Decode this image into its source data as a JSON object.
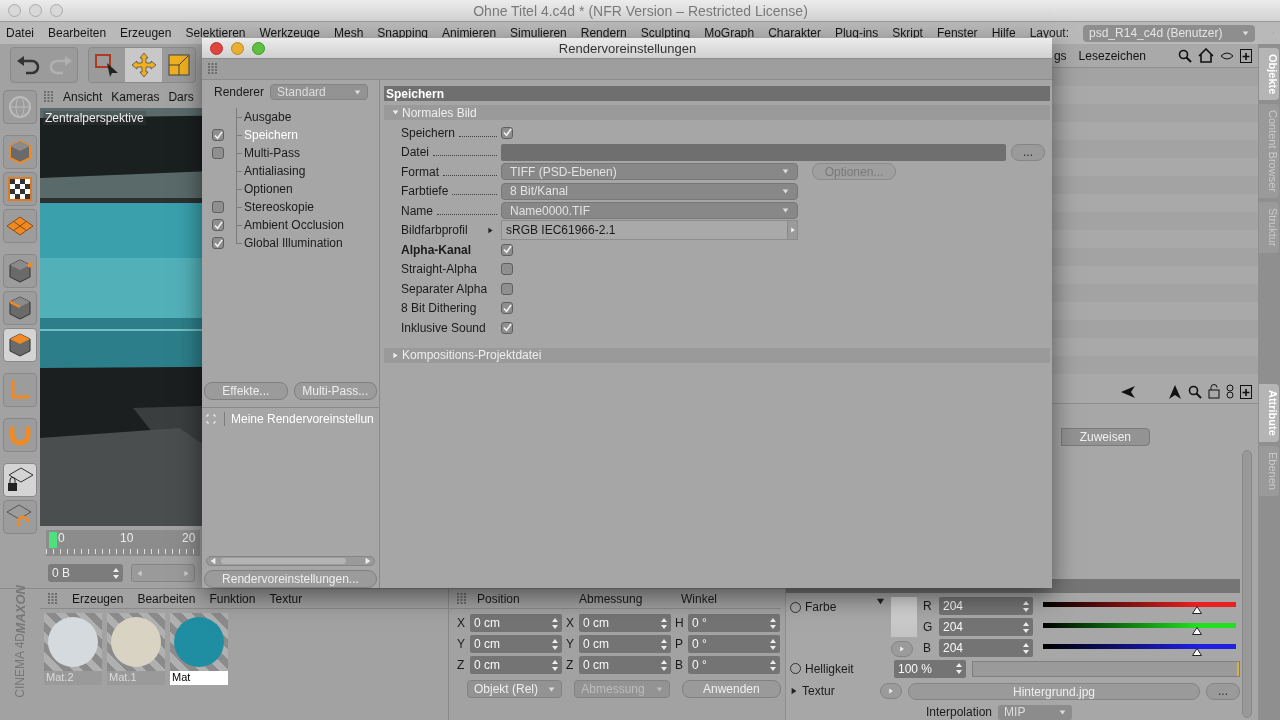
{
  "app_window": {
    "title": "Ohne Titel 4.c4d * (NFR Version – Restricted License)"
  },
  "menu_bar": {
    "items": [
      "Datei",
      "Bearbeiten",
      "Erzeugen",
      "Selektieren",
      "Werkzeuge",
      "Mesh",
      "Snapping",
      "Animieren",
      "Simulieren",
      "Rendern",
      "Sculpting",
      "MoGraph",
      "Charakter",
      "Plug-ins",
      "Skript",
      "Fenster",
      "Hilfe"
    ],
    "layout_label": "Layout:",
    "layout_value": "psd_R14_c4d (Benutzer)"
  },
  "viewport": {
    "menu": [
      "Ansicht",
      "Kameras",
      "Dars"
    ],
    "camera_label": "Zentralperspektive",
    "kind": "picture"
  },
  "timeline": {
    "ticks": [
      "0",
      "10",
      "20"
    ],
    "frame_field": "0 B"
  },
  "objects_panel": {
    "menu": [
      "gs",
      "Lesezeichen"
    ]
  },
  "side_tabs_top": [
    {
      "label": "Objekte",
      "selected": true
    },
    {
      "label": "Content Browser",
      "selected": false
    },
    {
      "label": "Struktur",
      "selected": false
    }
  ],
  "side_tabs_bottom": [
    {
      "label": "Attribute",
      "selected": true
    },
    {
      "label": "Ebenen",
      "selected": false
    }
  ],
  "render_settings_dialog": {
    "title": "Rendervoreinstellungen",
    "renderer_label": "Renderer",
    "renderer_value": "Standard",
    "sections": [
      {
        "label": "Ausgabe",
        "kind": "plain",
        "selected": false
      },
      {
        "label": "Speichern",
        "kind": "toggle",
        "checked": true,
        "selected": true
      },
      {
        "label": "Multi-Pass",
        "kind": "toggle",
        "checked": false,
        "selected": false
      },
      {
        "label": "Antialiasing",
        "kind": "plain",
        "selected": false
      },
      {
        "label": "Optionen",
        "kind": "plain",
        "selected": false
      },
      {
        "label": "Stereoskopie",
        "kind": "toggle",
        "checked": false,
        "selected": false
      },
      {
        "label": "Ambient Occlusion",
        "kind": "toggle",
        "checked": true,
        "selected": false
      },
      {
        "label": "Global Illumination",
        "kind": "toggle",
        "checked": true,
        "selected": false
      }
    ],
    "buttons": [
      "Effekte...",
      "Multi-Pass..."
    ],
    "preset": "Meine Rendervoreinstellun",
    "footer_button": "Rendervoreinstellungen...",
    "page": {
      "title": "Speichern",
      "groups": [
        {
          "label": "Normales Bild",
          "expanded": true,
          "rows": [
            {
              "label": "Speichern",
              "kind": "checkbox",
              "checked": true,
              "bold": false,
              "leader": true
            },
            {
              "label": "Datei",
              "kind": "file",
              "button": "...",
              "bold": false,
              "leader": true
            },
            {
              "label": "Format",
              "kind": "dropdown",
              "value": "TIFF (PSD-Ebenen)",
              "side_button": {
                "label": "Optionen...",
                "disabled": true
              },
              "bold": false,
              "leader": true
            },
            {
              "label": "Farbtiefe",
              "kind": "dropdown",
              "value": "8 Bit/Kanal",
              "bold": false,
              "leader": true
            },
            {
              "label": "Name",
              "kind": "dropdown",
              "value": "Name0000.TIF",
              "bold": false,
              "leader": true
            },
            {
              "label": "Bildfarbprofil",
              "kind": "profile",
              "value": "sRGB IEC61966-2.1",
              "bold": false,
              "leader": false
            },
            {
              "label": "Alpha-Kanal",
              "kind": "checkbox",
              "checked": true,
              "bold": true,
              "leader": false
            },
            {
              "label": "Straight-Alpha",
              "kind": "checkbox",
              "checked": false,
              "bold": false,
              "leader": false
            },
            {
              "label": "Separater Alpha",
              "kind": "checkbox",
              "checked": false,
              "bold": false,
              "leader": false
            },
            {
              "label": "8 Bit Dithering",
              "kind": "checkbox",
              "checked": true,
              "bold": false,
              "leader": false
            },
            {
              "label": "Inklusive Sound",
              "kind": "checkbox",
              "checked": true,
              "bold": false,
              "leader": false
            }
          ]
        },
        {
          "label": "Kompositions-Projektdatei",
          "expanded": false
        }
      ]
    }
  },
  "logo": {
    "line_1": "MAXON",
    "line_2": "CINEMA 4D"
  },
  "materials_panel": {
    "menu": [
      "Erzeugen",
      "Bearbeiten",
      "Funktion",
      "Textur"
    ],
    "materials": [
      {
        "name": "Mat.2",
        "color": "#d4dadd",
        "selected": false
      },
      {
        "name": "Mat.1",
        "color": "#d8d3c3",
        "selected": false
      },
      {
        "name": "Mat",
        "color": "#1f8ea3",
        "selected": true
      }
    ]
  },
  "coordinates_panel": {
    "headers": [
      "Position",
      "Abmessung",
      "Winkel"
    ],
    "rows": [
      [
        {
          "axis": "X",
          "value": "0 cm"
        },
        {
          "axis": "X",
          "value": "0 cm"
        },
        {
          "axis": "H",
          "value": "0 °"
        }
      ],
      [
        {
          "axis": "Y",
          "value": "0 cm"
        },
        {
          "axis": "Y",
          "value": "0 cm"
        },
        {
          "axis": "P",
          "value": "0 °"
        }
      ],
      [
        {
          "axis": "Z",
          "value": "0 cm"
        },
        {
          "axis": "Z",
          "value": "0 cm"
        },
        {
          "axis": "B",
          "value": "0 °"
        }
      ]
    ],
    "dropdowns": [
      {
        "label": "Objekt (Rel)",
        "disabled": false
      },
      {
        "label": "Abmessung",
        "disabled": true
      }
    ],
    "apply_button": "Anwenden"
  },
  "attributes_panel": {
    "assign_button": "Zuweisen",
    "color_label": "Farbe",
    "color_radio_checked": false,
    "brightness_radio_checked": false,
    "channels": [
      {
        "name": "R",
        "reading": "204",
        "level": 0.8,
        "color": "#e82020"
      },
      {
        "name": "G",
        "reading": "204",
        "level": 0.8,
        "color": "#20e020"
      },
      {
        "name": "B",
        "reading": "204",
        "level": 0.8,
        "color": "#2020e0"
      }
    ],
    "brightness_label": "Helligkeit",
    "brightness_value": "100 %",
    "brightness": {
      "level": 1
    },
    "texture_label": "Textur",
    "texture_file": "Hintergrund.jpg",
    "texture_button": "...",
    "interpolation_label": "Interpolation",
    "interpolation_value": "MIP"
  }
}
